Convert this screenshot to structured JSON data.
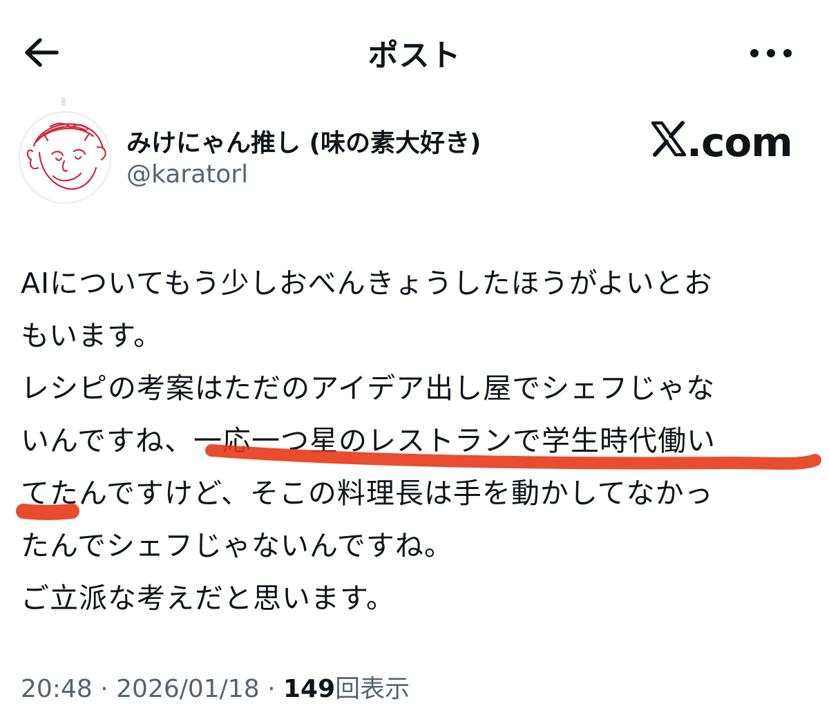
{
  "header": {
    "title": "ポスト",
    "back_icon": "back-arrow-icon",
    "more_icon": "more-horizontal-icon"
  },
  "author": {
    "display_name": "みけにゃん推し (味の素大好き)",
    "handle": "@karatorl",
    "avatar": "hand-drawn-face-avatar"
  },
  "watermark": {
    "x_letter": "X",
    "suffix": ".com"
  },
  "post": {
    "lines": [
      "AIについてもう少しおべんきょうしたほうがよいとお",
      "もいます。",
      "レシピの考案はただのアイデア出し屋でシェフじゃな",
      "いんですね、一応一つ星のレストランで学生時代働い",
      "てたんですけど、そこの料理長は手を動かしてなかっ",
      "たんでシェフじゃないんですね。",
      "ご立派な考えだと思います。"
    ],
    "highlight_color": "#e8381a"
  },
  "meta": {
    "time": "20:48",
    "separator": "·",
    "date": "2026/01/18",
    "views_count": "149",
    "views_label": "回表示"
  },
  "colors": {
    "text_primary": "#0f1419",
    "text_secondary": "#536471",
    "annotation_red": "#e8381a"
  }
}
